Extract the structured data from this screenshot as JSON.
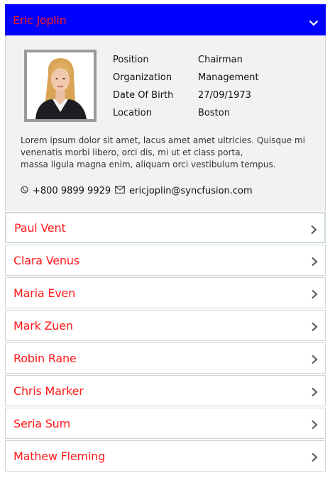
{
  "expanded": {
    "name": "Eric Joplin",
    "details": [
      {
        "label": "Position",
        "value": "Chairman"
      },
      {
        "label": "Organization",
        "value": "Management"
      },
      {
        "label": "Date Of Birth",
        "value": "27/09/1973"
      },
      {
        "label": "Location",
        "value": "Boston"
      }
    ],
    "bio_lines": [
      "Lorem ipsum dolor sit amet, lacus amet amet ultricies. Quisque mi",
      "venenatis morbi libero, orci dis, mi ut et class porta,",
      "massa ligula magna enim, aliquam orci vestibulum tempus."
    ],
    "phone": "+800 9899 9929",
    "email": "ericjoplin@syncfusion.com"
  },
  "items": [
    {
      "name": "Paul Vent"
    },
    {
      "name": "Clara Venus"
    },
    {
      "name": "Maria Even"
    },
    {
      "name": "Mark Zuen"
    },
    {
      "name": "Robin Rane"
    },
    {
      "name": "Chris Marker"
    },
    {
      "name": "Seria Sum"
    },
    {
      "name": "Mathew Fleming"
    }
  ],
  "colors": {
    "header_bg": "#0000ff",
    "name_text": "#ff1a1a",
    "panel_bg": "#f3f2f1"
  },
  "icons": {
    "header_toggle": "chevron-up-icon",
    "item_toggle": "chevron-right-icon",
    "phone": "phone-icon",
    "email": "mail-icon"
  }
}
